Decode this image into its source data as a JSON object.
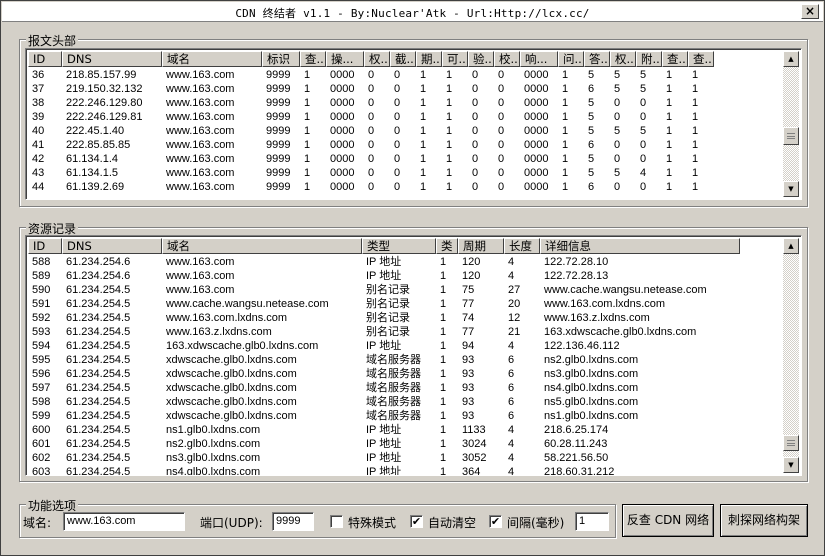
{
  "window": {
    "title": "CDN 终结者 v1.1 - By:Nuclear'Atk - Url:Http://lcx.cc/",
    "close_glyph": "×"
  },
  "header_group": {
    "label": "报文头部",
    "columns": [
      "ID",
      "DNS",
      "域名",
      "标识",
      "查...",
      "操...",
      "权...",
      "截...",
      "期...",
      "可...",
      "验...",
      "校...",
      "响...",
      "问...",
      "答...",
      "权...",
      "附...",
      "查...",
      "查..."
    ],
    "rows": [
      [
        "36",
        "218.85.157.99",
        "www.163.com",
        "9999",
        "1",
        "0000",
        "0",
        "0",
        "1",
        "1",
        "0",
        "0",
        "0000",
        "1",
        "5",
        "5",
        "5",
        "1",
        "1"
      ],
      [
        "37",
        "219.150.32.132",
        "www.163.com",
        "9999",
        "1",
        "0000",
        "0",
        "0",
        "1",
        "1",
        "0",
        "0",
        "0000",
        "1",
        "6",
        "5",
        "5",
        "1",
        "1"
      ],
      [
        "38",
        "222.246.129.80",
        "www.163.com",
        "9999",
        "1",
        "0000",
        "0",
        "0",
        "1",
        "1",
        "0",
        "0",
        "0000",
        "1",
        "5",
        "0",
        "0",
        "1",
        "1"
      ],
      [
        "39",
        "222.246.129.81",
        "www.163.com",
        "9999",
        "1",
        "0000",
        "0",
        "0",
        "1",
        "1",
        "0",
        "0",
        "0000",
        "1",
        "5",
        "0",
        "0",
        "1",
        "1"
      ],
      [
        "40",
        "222.45.1.40",
        "www.163.com",
        "9999",
        "1",
        "0000",
        "0",
        "0",
        "1",
        "1",
        "0",
        "0",
        "0000",
        "1",
        "5",
        "5",
        "5",
        "1",
        "1"
      ],
      [
        "41",
        "222.85.85.85",
        "www.163.com",
        "9999",
        "1",
        "0000",
        "0",
        "0",
        "1",
        "1",
        "0",
        "0",
        "0000",
        "1",
        "6",
        "0",
        "0",
        "1",
        "1"
      ],
      [
        "42",
        "61.134.1.4",
        "www.163.com",
        "9999",
        "1",
        "0000",
        "0",
        "0",
        "1",
        "1",
        "0",
        "0",
        "0000",
        "1",
        "5",
        "0",
        "0",
        "1",
        "1"
      ],
      [
        "43",
        "61.134.1.5",
        "www.163.com",
        "9999",
        "1",
        "0000",
        "0",
        "0",
        "1",
        "1",
        "0",
        "0",
        "0000",
        "1",
        "5",
        "5",
        "4",
        "1",
        "1"
      ],
      [
        "44",
        "61.139.2.69",
        "www.163.com",
        "9999",
        "1",
        "0000",
        "0",
        "0",
        "1",
        "1",
        "0",
        "0",
        "0000",
        "1",
        "6",
        "0",
        "0",
        "1",
        "1"
      ]
    ],
    "scroll_fraction": 0.62
  },
  "records_group": {
    "label": "资源记录",
    "columns": [
      "ID",
      "DNS",
      "域名",
      "类型",
      "类",
      "周期",
      "长度",
      "详细信息"
    ],
    "rows": [
      [
        "588",
        "61.234.254.6",
        "www.163.com",
        "IP 地址",
        "1",
        "120",
        "4",
        "122.72.28.10"
      ],
      [
        "589",
        "61.234.254.6",
        "www.163.com",
        "IP 地址",
        "1",
        "120",
        "4",
        "122.72.28.13"
      ],
      [
        "590",
        "61.234.254.5",
        "www.163.com",
        "别名记录",
        "1",
        "75",
        "27",
        "www.cache.wangsu.netease.com"
      ],
      [
        "591",
        "61.234.254.5",
        "www.cache.wangsu.netease.com",
        "别名记录",
        "1",
        "77",
        "20",
        "www.163.com.lxdns.com"
      ],
      [
        "592",
        "61.234.254.5",
        "www.163.com.lxdns.com",
        "别名记录",
        "1",
        "74",
        "12",
        "www.163.z.lxdns.com"
      ],
      [
        "593",
        "61.234.254.5",
        "www.163.z.lxdns.com",
        "别名记录",
        "1",
        "77",
        "21",
        "163.xdwscache.glb0.lxdns.com"
      ],
      [
        "594",
        "61.234.254.5",
        "163.xdwscache.glb0.lxdns.com",
        "IP 地址",
        "1",
        "94",
        "4",
        "122.136.46.112"
      ],
      [
        "595",
        "61.234.254.5",
        "xdwscache.glb0.lxdns.com",
        "域名服务器",
        "1",
        "93",
        "6",
        "ns2.glb0.lxdns.com"
      ],
      [
        "596",
        "61.234.254.5",
        "xdwscache.glb0.lxdns.com",
        "域名服务器",
        "1",
        "93",
        "6",
        "ns3.glb0.lxdns.com"
      ],
      [
        "597",
        "61.234.254.5",
        "xdwscache.glb0.lxdns.com",
        "域名服务器",
        "1",
        "93",
        "6",
        "ns4.glb0.lxdns.com"
      ],
      [
        "598",
        "61.234.254.5",
        "xdwscache.glb0.lxdns.com",
        "域名服务器",
        "1",
        "93",
        "6",
        "ns5.glb0.lxdns.com"
      ],
      [
        "599",
        "61.234.254.5",
        "xdwscache.glb0.lxdns.com",
        "域名服务器",
        "1",
        "93",
        "6",
        "ns1.glb0.lxdns.com"
      ],
      [
        "600",
        "61.234.254.5",
        "ns1.glb0.lxdns.com",
        "IP 地址",
        "1",
        "1133",
        "4",
        "218.6.25.174"
      ],
      [
        "601",
        "61.234.254.5",
        "ns2.glb0.lxdns.com",
        "IP 地址",
        "1",
        "3024",
        "4",
        "60.28.11.243"
      ],
      [
        "602",
        "61.234.254.5",
        "ns3.glb0.lxdns.com",
        "IP 地址",
        "1",
        "3052",
        "4",
        "58.221.56.50"
      ],
      [
        "603",
        "61.234.254.5",
        "ns4.glb0.lxdns.com",
        "IP 地址",
        "1",
        "364",
        "4",
        "218.60.31.212"
      ]
    ],
    "scroll_fraction": 0.97
  },
  "options_group": {
    "label": "功能选项",
    "domain_label": "域名:",
    "domain_value": "www.163.com",
    "port_label": "端口(UDP):",
    "port_value": "9999",
    "special_mode_label": "特殊模式",
    "special_mode_checked": false,
    "auto_clear_label": "自动清空",
    "auto_clear_checked": true,
    "interval_label": "间隔(毫秒)",
    "interval_checked": true,
    "interval_value": "1",
    "check_mark": "✔"
  },
  "buttons": {
    "reverse_lookup": "反查 CDN 网络",
    "draw_network": "刺探网络构架"
  }
}
